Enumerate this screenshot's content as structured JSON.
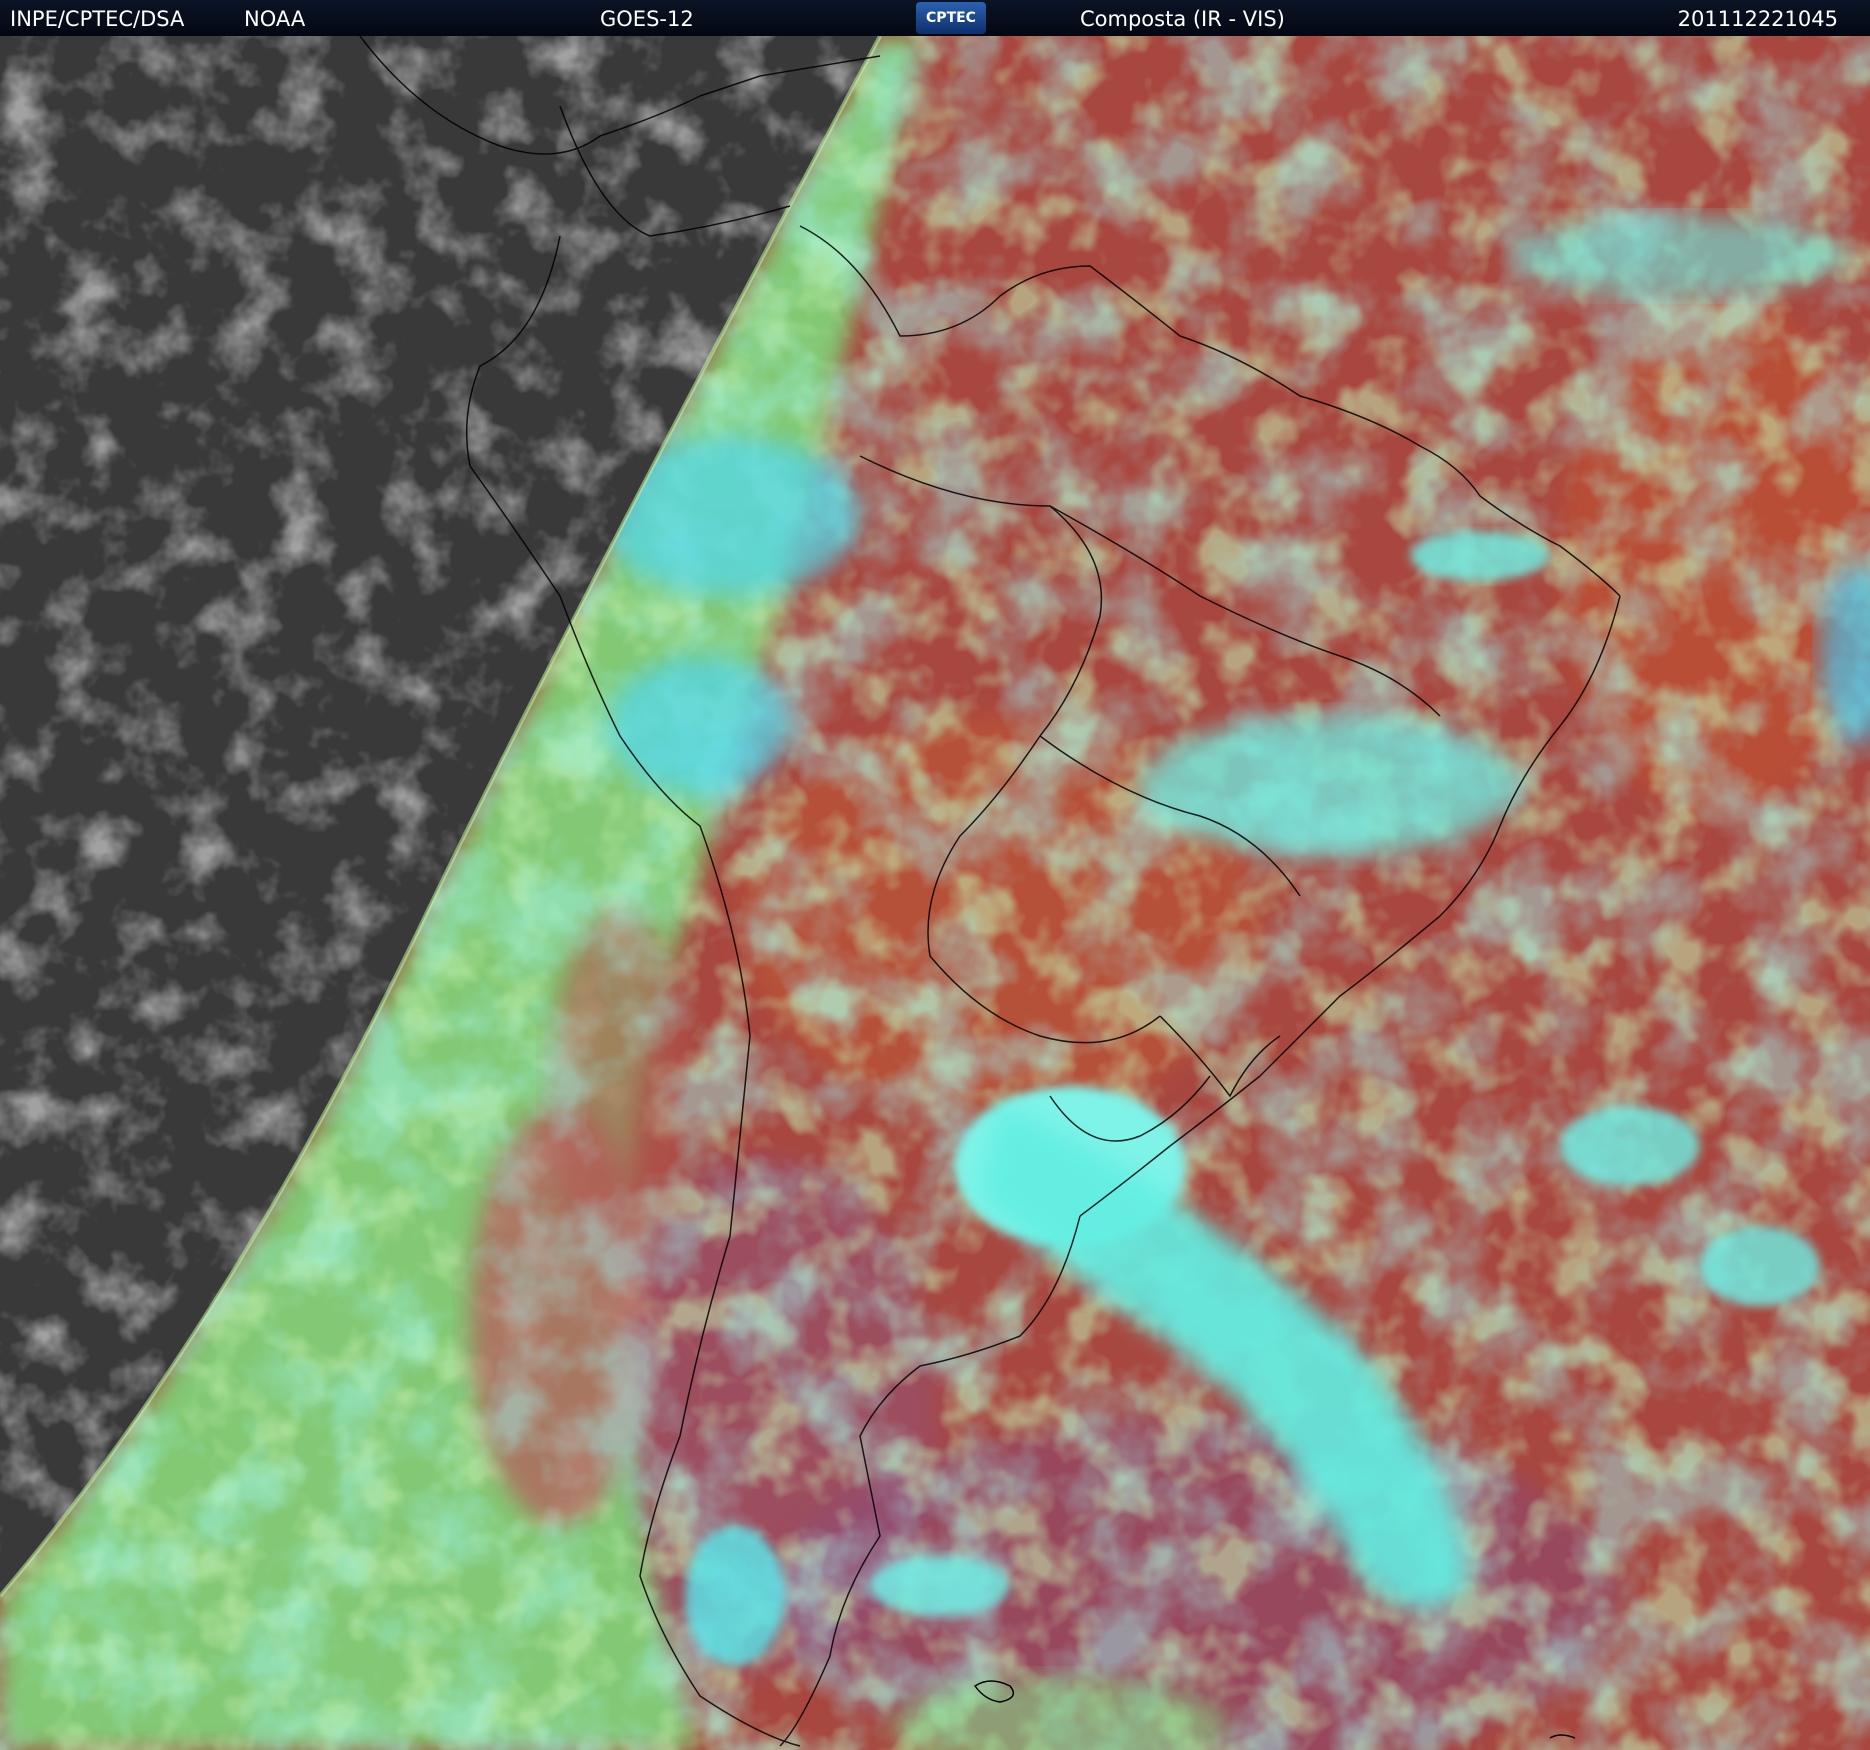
{
  "header": {
    "institution": "INPE/CPTEC/DSA",
    "agency": "NOAA",
    "satellite": "GOES-12",
    "logo_text": "CPTEC",
    "product": "Composta (IR - VIS)",
    "timestamp": "201112221045"
  },
  "palette": {
    "night_side": "#3a3a3a",
    "land_surface": "#a8473f",
    "low_cloud": "#8ee07a",
    "high_cloud": "#59efe6",
    "header_bg": "#061022",
    "outline": "#000000"
  }
}
